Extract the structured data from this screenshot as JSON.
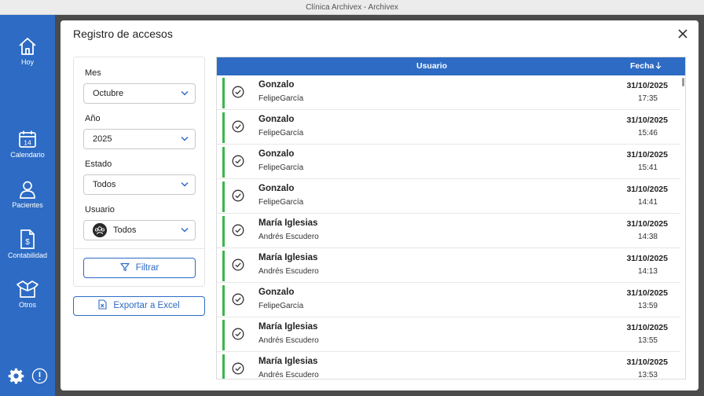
{
  "window": {
    "title": "Clínica Archivex - Archivex"
  },
  "sidebar": {
    "items": [
      {
        "label": "Hoy",
        "icon": "home-icon"
      },
      {
        "label": "Calendario",
        "icon": "calendar-icon",
        "badge": "14"
      },
      {
        "label": "Pacientes",
        "icon": "person-icon"
      },
      {
        "label": "Contabilidad",
        "icon": "invoice-icon"
      },
      {
        "label": "Otros",
        "icon": "box-icon"
      }
    ],
    "bottom": {
      "settings_icon": "gear-icon",
      "info_icon": "info-icon"
    },
    "color": "#2d6bc4"
  },
  "modal": {
    "title": "Registro de accesos",
    "filters": {
      "mes": {
        "label": "Mes",
        "value": "Octubre"
      },
      "anio": {
        "label": "Año",
        "value": "2025"
      },
      "estado": {
        "label": "Estado",
        "value": "Todos"
      },
      "usuario": {
        "label": "Usuario",
        "value": "Todos"
      },
      "filter_button": "Filtrar"
    },
    "export_button": "Exportar a Excel",
    "table": {
      "columns": {
        "user": "Usuario",
        "date": "Fecha"
      },
      "rows": [
        {
          "name": "Gonzalo",
          "sub": "FelipeGarcía",
          "date": "31/10/2025",
          "time": "17:35"
        },
        {
          "name": "Gonzalo",
          "sub": "FelipeGarcía",
          "date": "31/10/2025",
          "time": "15:46"
        },
        {
          "name": "Gonzalo",
          "sub": "FelipeGarcía",
          "date": "31/10/2025",
          "time": "15:41"
        },
        {
          "name": "Gonzalo",
          "sub": "FelipeGarcía",
          "date": "31/10/2025",
          "time": "14:41"
        },
        {
          "name": "María Iglesias",
          "sub": "Andrés Escudero",
          "date": "31/10/2025",
          "time": "14:38"
        },
        {
          "name": "María Iglesias",
          "sub": "Andrés Escudero",
          "date": "31/10/2025",
          "time": "14:13"
        },
        {
          "name": "Gonzalo",
          "sub": "FelipeGarcía",
          "date": "31/10/2025",
          "time": "13:59"
        },
        {
          "name": "María Iglesias",
          "sub": "Andrés Escudero",
          "date": "31/10/2025",
          "time": "13:55"
        },
        {
          "name": "María Iglesias",
          "sub": "Andrés Escudero",
          "date": "31/10/2025",
          "time": "13:53"
        }
      ],
      "status_color": "#3cb54a",
      "header_color": "#2d6bc4"
    }
  }
}
